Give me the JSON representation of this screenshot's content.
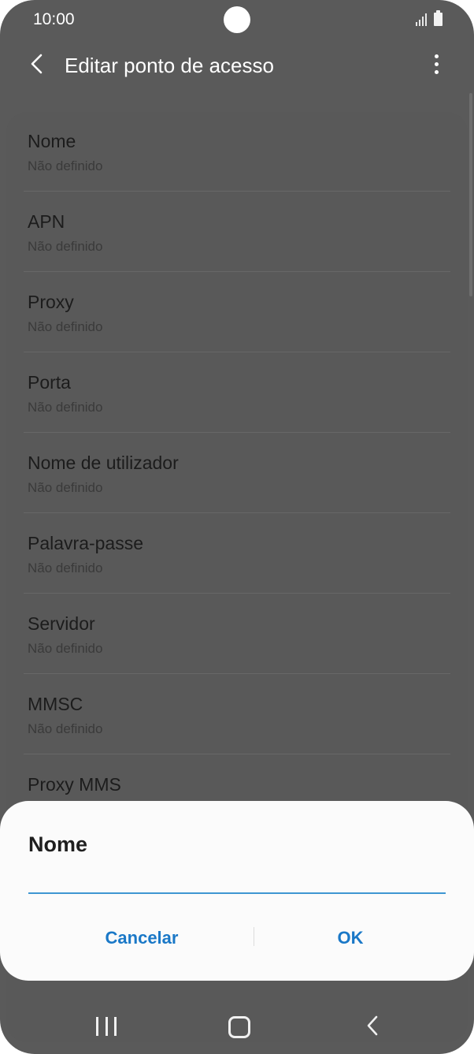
{
  "status_bar": {
    "time": "10:00",
    "signal_icon": "signal-icon",
    "battery_icon": "battery-icon"
  },
  "app_bar": {
    "title": "Editar ponto de acesso",
    "back_icon": "back-arrow-icon",
    "more_icon": "more-vertical-icon"
  },
  "settings": {
    "items": [
      {
        "title": "Nome",
        "value": "Não definido"
      },
      {
        "title": "APN",
        "value": "Não definido"
      },
      {
        "title": "Proxy",
        "value": "Não definido"
      },
      {
        "title": "Porta",
        "value": "Não definido"
      },
      {
        "title": "Nome de utilizador",
        "value": "Não definido"
      },
      {
        "title": "Palavra-passe",
        "value": "Não definido"
      },
      {
        "title": "Servidor",
        "value": "Não definido"
      },
      {
        "title": "MMSC",
        "value": "Não definido"
      },
      {
        "title": "Proxy MMS",
        "value": ""
      }
    ]
  },
  "dialog": {
    "title": "Nome",
    "input_value": "",
    "cancel_label": "Cancelar",
    "ok_label": "OK"
  },
  "nav_bar": {
    "recent_icon": "recent-apps-icon",
    "home_icon": "home-icon",
    "back_icon": "nav-back-icon"
  },
  "colors": {
    "accent": "#1a78c7",
    "input_underline": "#3e96d2",
    "scrim": "#5a5a5a"
  }
}
